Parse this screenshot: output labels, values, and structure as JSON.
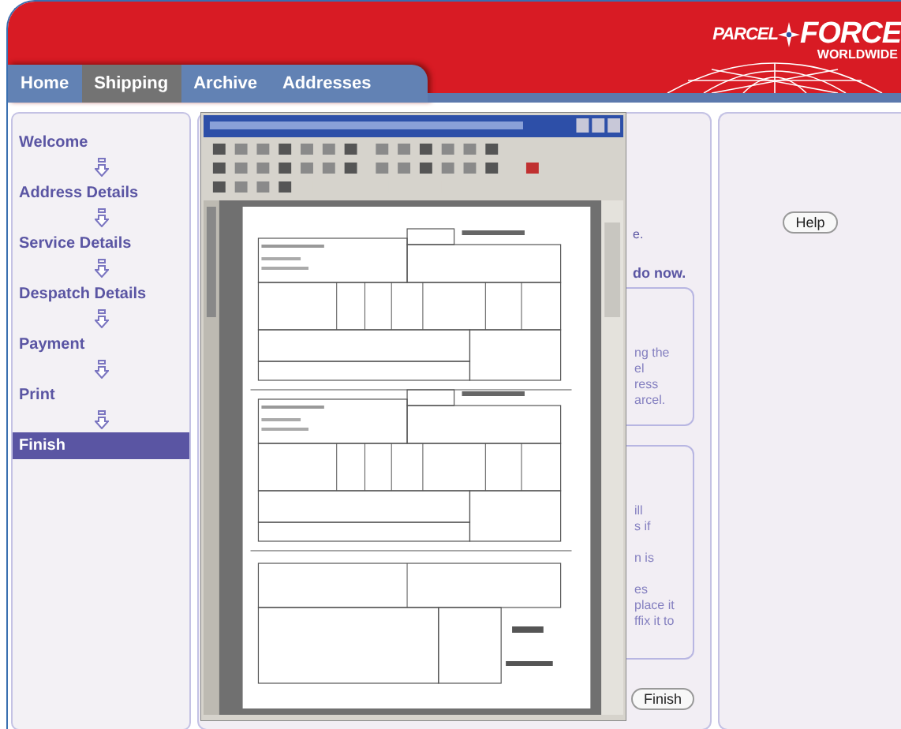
{
  "tabs": [
    {
      "label": "Home",
      "selected": false
    },
    {
      "label": "Shipping",
      "selected": true
    },
    {
      "label": "Archive",
      "selected": false
    },
    {
      "label": "Addresses",
      "selected": false
    }
  ],
  "logo": {
    "word_1": "PARCEL",
    "word_2": "FORCE",
    "tagline": "WORLDWIDE"
  },
  "steps": [
    {
      "label": "Welcome",
      "selected": false
    },
    {
      "label": "Address Details",
      "selected": false
    },
    {
      "label": "Service Details",
      "selected": false
    },
    {
      "label": "Despatch Details",
      "selected": false
    },
    {
      "label": "Payment",
      "selected": false
    },
    {
      "label": "Print",
      "selected": false
    },
    {
      "label": "Finish",
      "selected": true
    }
  ],
  "main": {
    "intro": "e.",
    "heading": "do now.",
    "box_1": [
      [
        "ng the",
        "el",
        "ress",
        "arcel."
      ]
    ],
    "box_2": [
      [
        "ill",
        "s if"
      ],
      [
        "n is"
      ],
      [
        "es",
        "place it",
        "ffix it to"
      ]
    ],
    "finish_button": "Finish"
  },
  "help_button": "Help"
}
